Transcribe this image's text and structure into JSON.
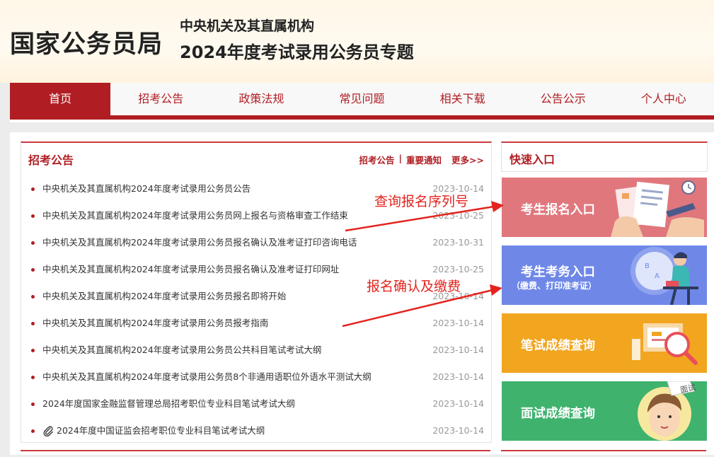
{
  "header": {
    "logo": "国家公务员局",
    "subtitle": "中央机关及其直属机构",
    "title": "2024年度考试录用公务员专题"
  },
  "nav": {
    "items": [
      "首页",
      "招考公告",
      "政策法规",
      "常见问题",
      "相关下载",
      "公告公示",
      "个人中心"
    ],
    "active": "首页"
  },
  "announcements": {
    "title": "招考公告",
    "links": [
      "招考公告",
      "重要通知"
    ],
    "separator": "|",
    "more": "更多>>",
    "items": [
      {
        "title": "中央机关及其直属机构2024年度考试录用公务员公告",
        "date": "2023-10-14"
      },
      {
        "title": "中央机关及其直属机构2024年度考试录用公务员网上报名与资格审查工作结束",
        "date": "2023-10-25"
      },
      {
        "title": "中央机关及其直属机构2024年度考试录用公务员报名确认及准考证打印咨询电话",
        "date": "2023-10-31"
      },
      {
        "title": "中央机关及其直属机构2024年度考试录用公务员报名确认及准考证打印网址",
        "date": "2023-10-25"
      },
      {
        "title": "中央机关及其直属机构2024年度考试录用公务员报名即将开始",
        "date": "2023-10-14"
      },
      {
        "title": "中央机关及其直属机构2024年度考试录用公务员报考指南",
        "date": "2023-10-14"
      },
      {
        "title": "中央机关及其直属机构2024年度考试录用公务员公共科目笔试考试大纲",
        "date": "2023-10-14"
      },
      {
        "title": "中央机关及其直属机构2024年度考试录用公务员8个非通用语职位外语水平测试大纲",
        "date": "2023-10-14"
      },
      {
        "title": "2024年度国家金融监督管理总局招考职位专业科目笔试考试大纲",
        "date": "2023-10-14"
      },
      {
        "title": "2024年度中国证监会招考职位专业科目笔试考试大纲",
        "date": "2023-10-14",
        "attachment": true
      }
    ]
  },
  "quick": {
    "title": "快速入口",
    "tiles": [
      {
        "label": "考生报名入口",
        "color": "#e0777d"
      },
      {
        "label": "考生考务入口",
        "sub": "（缴费、打印准考证）",
        "color": "#6f88e8"
      },
      {
        "label": "笔试成绩查询",
        "color": "#f2a51f"
      },
      {
        "label": "面试成绩查询",
        "color": "#3fb36e"
      }
    ],
    "interview_bubble": "面试"
  },
  "annotations": {
    "query_serial": "查询报名序列号",
    "confirm_pay": "报名确认及缴费",
    "color": "#e3241d"
  },
  "icons": [
    "paperclip-icon",
    "document-illustration-icon",
    "person-at-desk-illustration-icon",
    "magnifier-illustration-icon",
    "face-illustration-icon"
  ]
}
